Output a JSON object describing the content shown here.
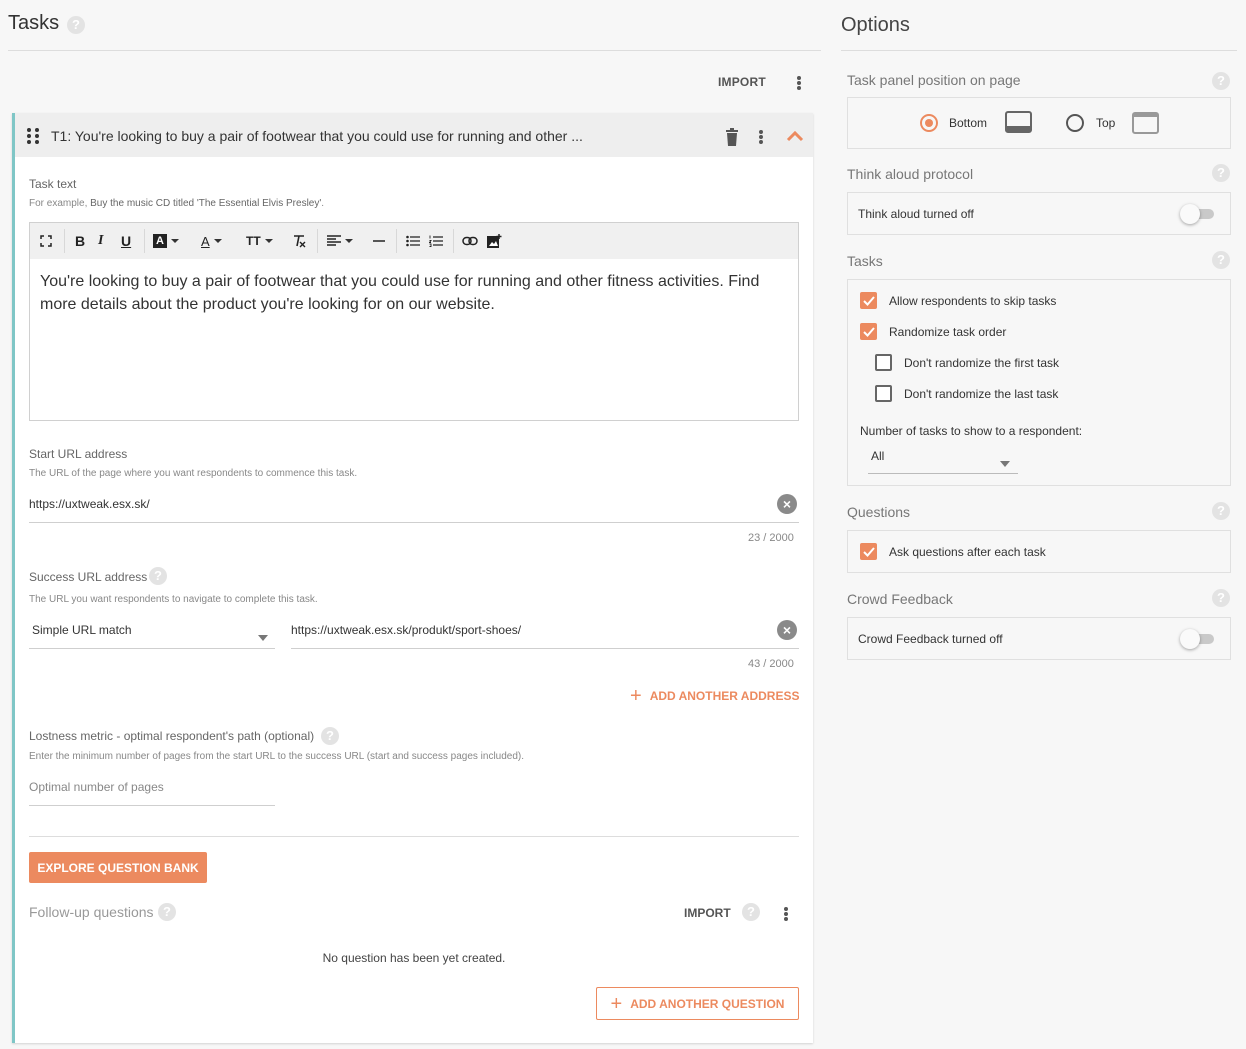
{
  "tasks_panel": {
    "title": "Tasks",
    "import_label": "IMPORT",
    "task": {
      "title": "T1: You're looking to buy a pair of footwear that you could use for running and other ...",
      "task_text_label": "Task text",
      "task_text_example_prefix": "For example, ",
      "task_text_example_value": "Buy the music CD titled 'The Essential Elvis Presley'",
      "task_text_example_suffix": ".",
      "task_text": "You're looking to buy a pair of footwear that you could use for running and other fitness activities. Find more details about the product you're looking for on our website.",
      "start_url": {
        "label": "Start URL address",
        "hint": "The URL of the page where you want respondents to commence this task.",
        "value": "https://uxtweak.esx.sk/",
        "counter": "23 / 2000"
      },
      "success_url": {
        "label": "Success URL address",
        "hint": "The URL you want respondents to navigate to complete this task.",
        "match_type": "Simple URL match",
        "value": "https://uxtweak.esx.sk/produkt/sport-shoes/",
        "counter": "43 / 2000",
        "add_address_label": "ADD ANOTHER ADDRESS"
      },
      "lostness": {
        "label": "Lostness metric - optimal respondent's path (optional)",
        "hint": "Enter the minimum number of pages from the start URL to the success URL (start and success pages included).",
        "placeholder": "Optimal number of pages"
      },
      "explore_button": "EXPLORE QUESTION BANK",
      "followup": {
        "label": "Follow-up questions",
        "import_label": "IMPORT",
        "empty_text": "No question has been yet created.",
        "add_label": "ADD ANOTHER QUESTION"
      }
    }
  },
  "options_panel": {
    "title": "Options",
    "position": {
      "title": "Task panel position on page",
      "options": [
        {
          "label": "Bottom",
          "selected": true
        },
        {
          "label": "Top",
          "selected": false
        }
      ]
    },
    "think_aloud": {
      "title": "Think aloud protocol",
      "label": "Think aloud turned off",
      "enabled": false
    },
    "tasks": {
      "title": "Tasks",
      "checkboxes": [
        {
          "label": "Allow respondents to skip tasks",
          "checked": true
        },
        {
          "label": "Randomize task order",
          "checked": true
        },
        {
          "label": "Don't randomize the first task",
          "checked": false
        },
        {
          "label": "Don't randomize the last task",
          "checked": false
        }
      ],
      "count_label": "Number of tasks to show to a respondent:",
      "count_value": "All"
    },
    "questions": {
      "title": "Questions",
      "label": "Ask questions after each task",
      "checked": true
    },
    "crowd_feedback": {
      "title": "Crowd Feedback",
      "label": "Crowd Feedback turned off",
      "enabled": false
    }
  },
  "colors": {
    "accent": "#ec8a5f",
    "card_border": "#7fc6c6"
  }
}
